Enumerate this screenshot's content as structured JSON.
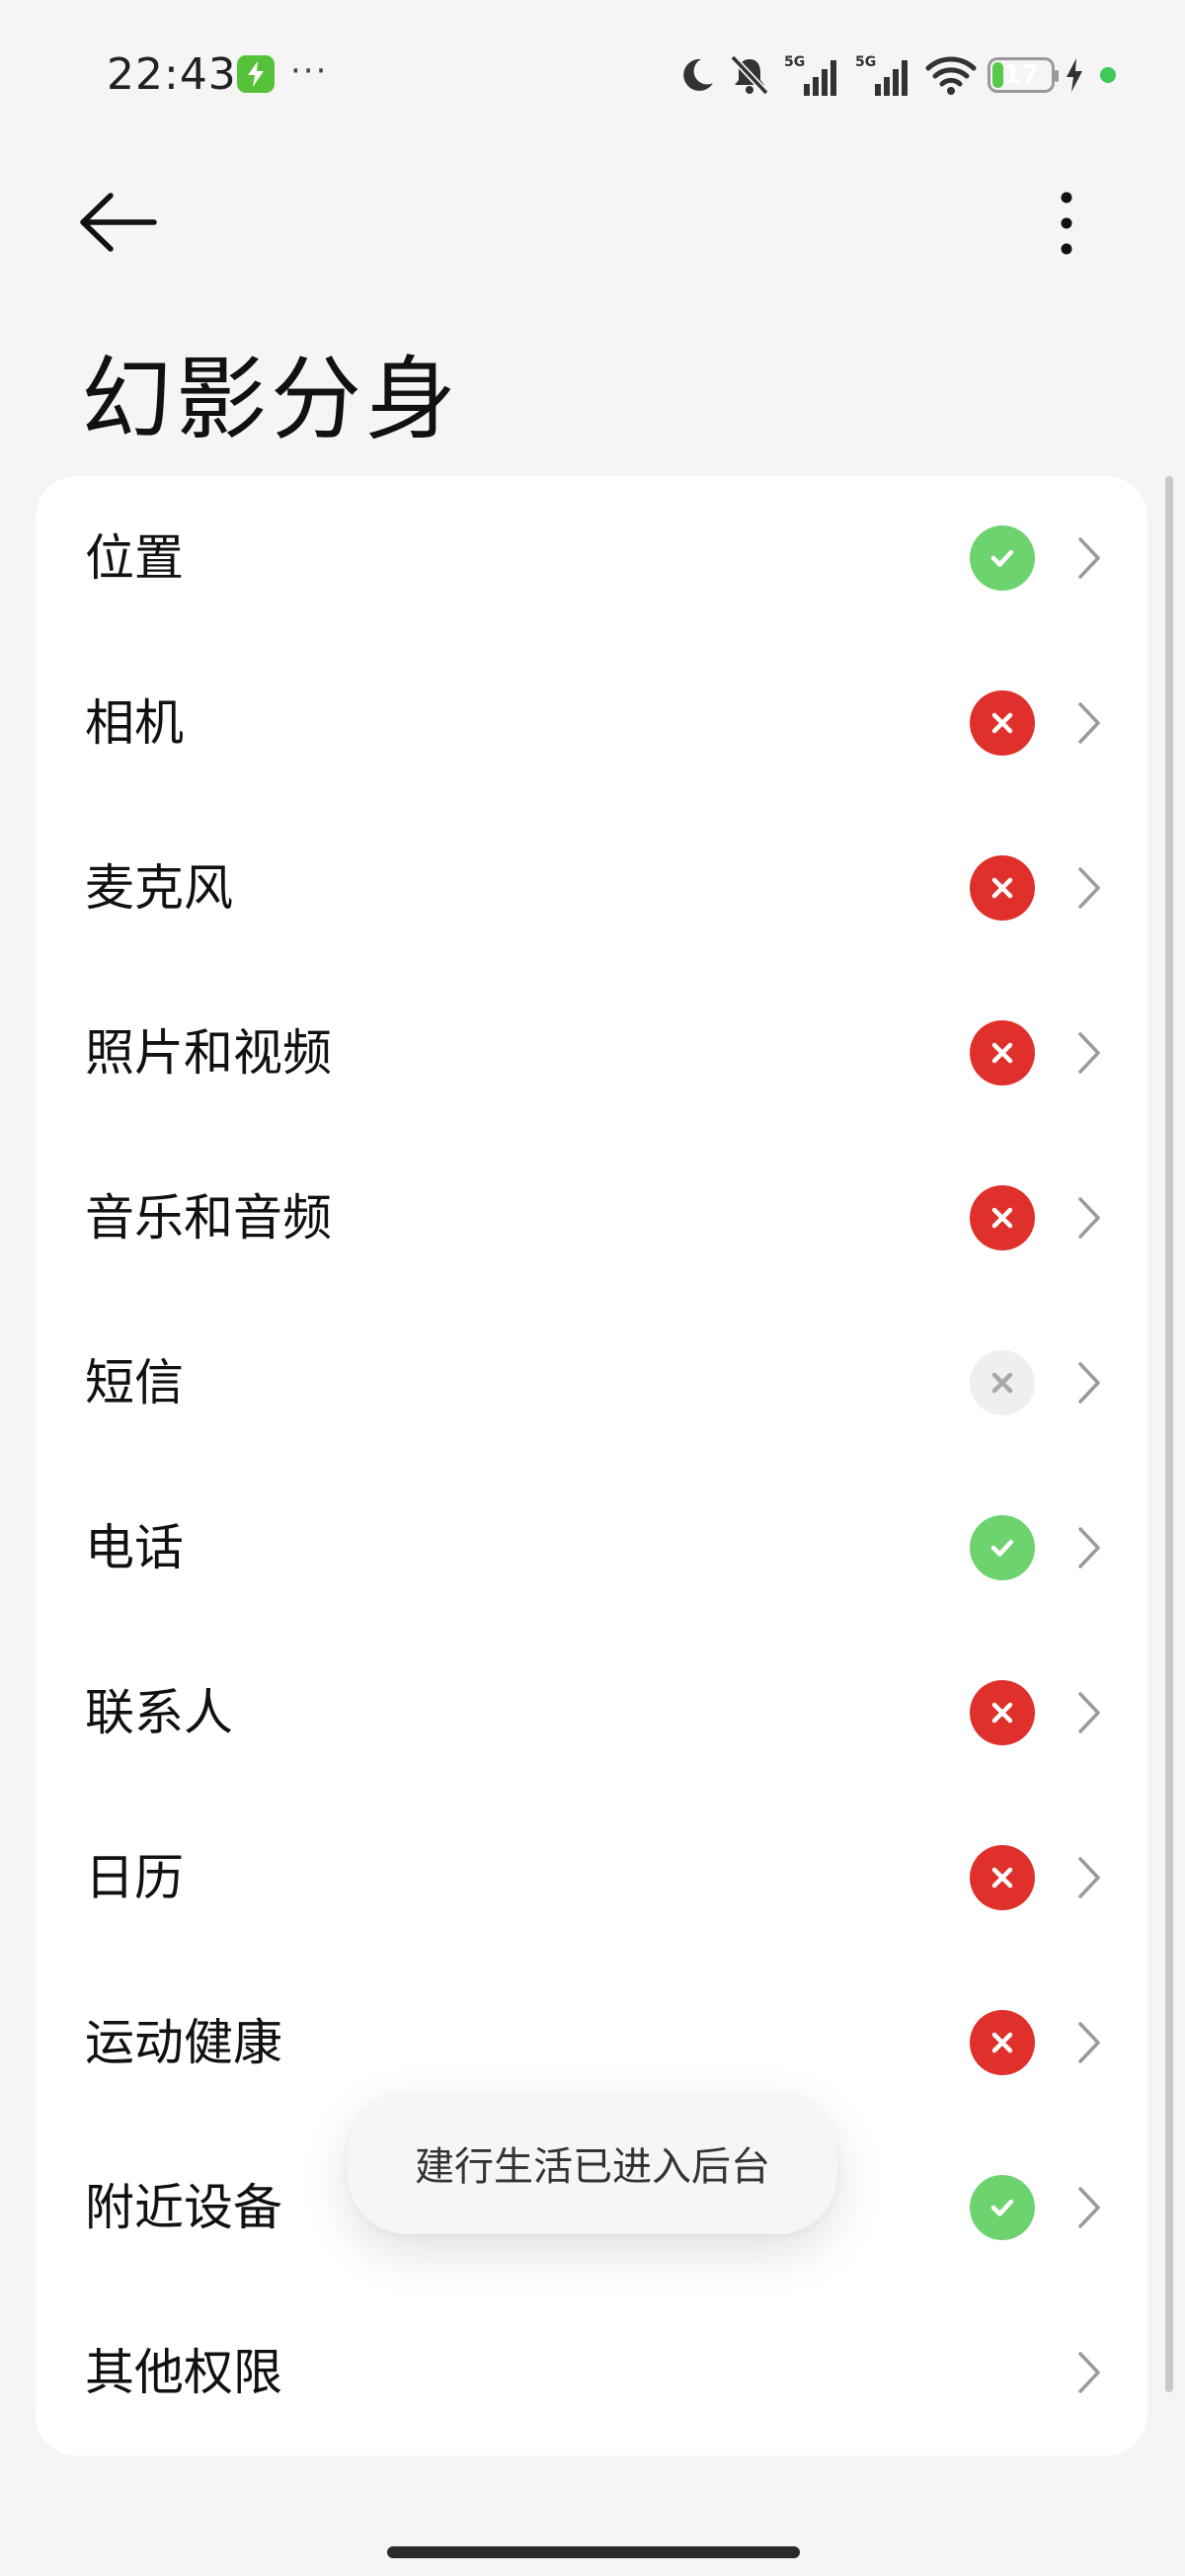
{
  "status_bar": {
    "time": "22:43",
    "app_notification_icon": "green-bolt-app-icon",
    "more_notifications": "···",
    "network_1": "5G",
    "network_2": "5G",
    "battery_level": "17",
    "battery_percent": 0.17,
    "icons": [
      "moon-icon",
      "muted-bell-icon",
      "signal-icon",
      "signal-icon",
      "wifi-icon",
      "battery-icon",
      "charging-bolt-icon",
      "privacy-dot-icon"
    ]
  },
  "app_bar": {
    "back_icon": "arrow-left-icon",
    "more_icon": "more-vertical-icon"
  },
  "page": {
    "title": "幻影分身"
  },
  "permissions": [
    {
      "label": "位置",
      "status": "allowed",
      "icon": "check-icon"
    },
    {
      "label": "相机",
      "status": "denied",
      "icon": "x-icon"
    },
    {
      "label": "麦克风",
      "status": "denied",
      "icon": "x-icon"
    },
    {
      "label": "照片和视频",
      "status": "denied",
      "icon": "x-icon"
    },
    {
      "label": "音乐和音频",
      "status": "denied",
      "icon": "x-icon"
    },
    {
      "label": "短信",
      "status": "unavailable",
      "icon": "x-icon"
    },
    {
      "label": "电话",
      "status": "allowed",
      "icon": "check-icon"
    },
    {
      "label": "联系人",
      "status": "denied",
      "icon": "x-icon"
    },
    {
      "label": "日历",
      "status": "denied",
      "icon": "x-icon"
    },
    {
      "label": "运动健康",
      "status": "denied",
      "icon": "x-icon"
    },
    {
      "label": "附近设备",
      "status": "allowed",
      "icon": "check-icon"
    },
    {
      "label": "其他权限",
      "status": "none",
      "icon": ""
    }
  ],
  "toast": {
    "text": "建行生活已进入后台"
  },
  "colors": {
    "allowed": "#6dd36f",
    "denied": "#e0302b",
    "unavailable": "#efefef",
    "background": "#f5f5f5",
    "card": "#ffffff"
  }
}
